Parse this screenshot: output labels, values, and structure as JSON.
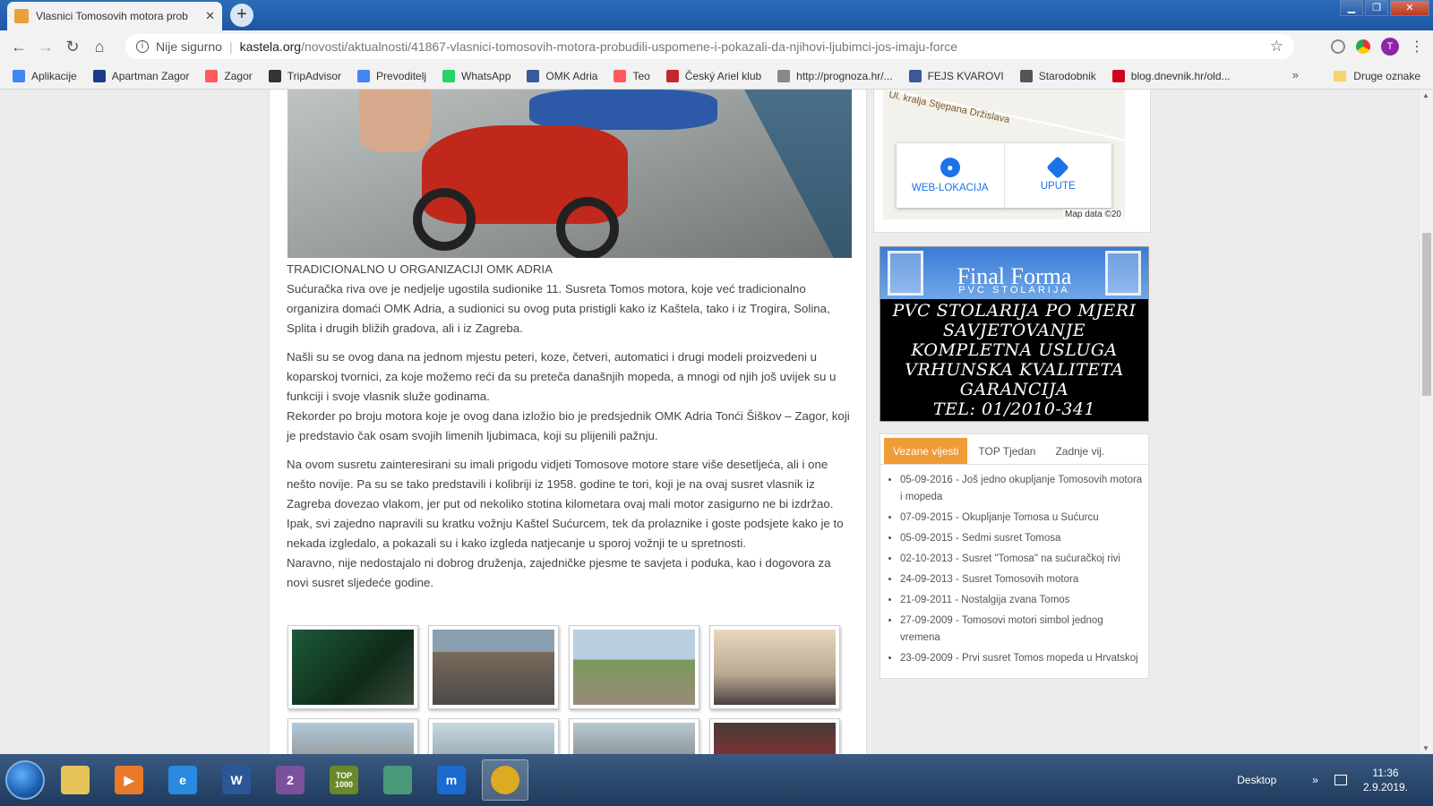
{
  "browser": {
    "tab_title": "Vlasnici Tomosovih motora prob",
    "tab_close": "✕",
    "new_tab": "+",
    "window_controls": [
      "▁",
      "❐",
      "✕"
    ],
    "nav": {
      "back": "←",
      "forward": "→",
      "reload": "↻",
      "home": "⌂"
    },
    "address": {
      "security_label": "Nije sigurno",
      "domain": "kastela.org",
      "path": "/novosti/aktualnosti/41867-vlasnici-tomosovih-motora-probudili-uspomene-i-pokazali-da-njihovi-ljubimci-jos-imaju-force",
      "star": "☆"
    },
    "profile_initial": "T",
    "menu": "⋮",
    "bookmarks": [
      {
        "label": "Aplikacije",
        "color": "#4285f4"
      },
      {
        "label": "Apartman Zagor",
        "color": "#1a3a8a"
      },
      {
        "label": "Zagor",
        "color": "#ff5a5f"
      },
      {
        "label": "TripAdvisor",
        "color": "#333333"
      },
      {
        "label": "Prevoditelj",
        "color": "#4285f4"
      },
      {
        "label": "WhatsApp",
        "color": "#25d366"
      },
      {
        "label": "OMK Adria",
        "color": "#3b5998"
      },
      {
        "label": "Teo",
        "color": "#ff5a5f"
      },
      {
        "label": "Český Ariel klub",
        "color": "#c0282d"
      },
      {
        "label": "http://prognoza.hr/...",
        "color": "#888888"
      },
      {
        "label": "FEJS KVAROVI",
        "color": "#3b5998"
      },
      {
        "label": "Starodobnik",
        "color": "#555555"
      },
      {
        "label": "blog.dnevnik.hr/old...",
        "color": "#d0021b"
      }
    ],
    "bookmarks_more": "»",
    "other_bookmarks": "Druge oznake"
  },
  "article": {
    "heading": "TRADICIONALNO U ORGANIZACIJI OMK ADRIA",
    "paragraphs": [
      "Sućuračka riva ove je nedjelje ugostila sudionike 11. Susreta Tomos motora, koje već tradicionalno organizira domaći OMK Adria, a sudionici su ovog puta pristigli kako iz Kaštela, tako i iz Trogira, Solina, Splita i drugih bližih gradova, ali i iz Zagreba.",
      "Našli su se ovog dana na jednom mjestu peteri, koze, četveri, automatici i drugi modeli proizvedeni u koparskoj tvornici, za koje možemo reći da su preteča današnjih mopeda, a mnogi od njih još uvijek su u funkciji i svoje vlasnik služe godinama.",
      "Rekorder po broju motora koje je ovog dana izložio bio je predsjednik OMK Adria Tonći Šiškov – Zagor, koji je predstavio čak osam svojih limenih ljubimaca, koji su plijenili pažnju.",
      "Na ovom susretu zainteresirani su imali prigodu vidjeti Tomosove motore stare više desetljeća, ali i one nešto novije. Pa su se tako predstavili i kolibriji iz 1958. godine te tori, koji je na ovaj susret vlasnik iz Zagreba dovezao vlakom, jer put od nekoliko stotina kilometara ovaj mali motor zasigurno ne bi izdržao.",
      "Ipak, svi zajedno napravili su kratku vožnju Kaštel Sućurcem, tek da prolaznike i goste podsjete kako je to nekada izgledalo, a pokazali su i kako izgleda natjecanje u sporoj vožnji te u spretnosti.",
      "Naravno, nije nedostajalo ni dobrog druženja, zajedničke pjesme te savjeta i poduka, kao i dogovora za novi susret sljedeće godine."
    ]
  },
  "map": {
    "street": "Ul. kralja Stjepana Držislava",
    "website_label": "WEB-LOKACIJA",
    "directions_label": "UPUTE",
    "attribution": "Map data ©20"
  },
  "ad": {
    "brand": "Final Forma",
    "subtitle": "PVC STOLARIJA",
    "lines": [
      "PVC STOLARIJA PO MJERI",
      "SAVJETOVANJE",
      "KOMPLETNA USLUGA",
      "VRHUNSKA KVALITETA",
      "GARANCIJA",
      "TEL: 01/2010-341"
    ]
  },
  "news": {
    "tabs": [
      "Vezane vijesti",
      "TOP Tjedan",
      "Zadnje vij."
    ],
    "items": [
      "05-09-2016 - Još jedno okupljanje Tomosovih motora i mopeda",
      "07-09-2015 - Okupljanje Tomosa u Sućurcu",
      "05-09-2015 - Sedmi susret Tomosa",
      "02-10-2013 - Susret \"Tomosa\" na sućuračkoj rivi",
      "24-09-2013 - Susret Tomosovih motora",
      "21-09-2011 - Nostalgija zvana Tomos",
      "27-09-2009 - Tomosovi motori simbol jednog vremena",
      "23-09-2009 - Prvi susret Tomos mopeda u Hrvatskoj"
    ]
  },
  "taskbar": {
    "apps": [
      {
        "name": "explorer",
        "label": "",
        "color": "#e8c35a"
      },
      {
        "name": "media-player",
        "label": "▶",
        "color": "#e87a2a"
      },
      {
        "name": "internet-explorer",
        "label": "e",
        "color": "#2a8ae0"
      },
      {
        "name": "word",
        "label": "W",
        "color": "#2b5797"
      },
      {
        "name": "viber",
        "label": "2",
        "color": "#7b519d"
      },
      {
        "name": "top1000",
        "label": "TOP 1000",
        "color": "#6a8a2a"
      },
      {
        "name": "network-app",
        "label": "",
        "color": "#4a9a7a"
      },
      {
        "name": "mstore",
        "label": "m",
        "color": "#1a6ad0"
      },
      {
        "name": "chrome",
        "label": "",
        "color": "#ddaa22"
      }
    ],
    "desktop_label": "Desktop",
    "tray_more": "»",
    "time": "11:36",
    "date": "2.9.2019."
  }
}
